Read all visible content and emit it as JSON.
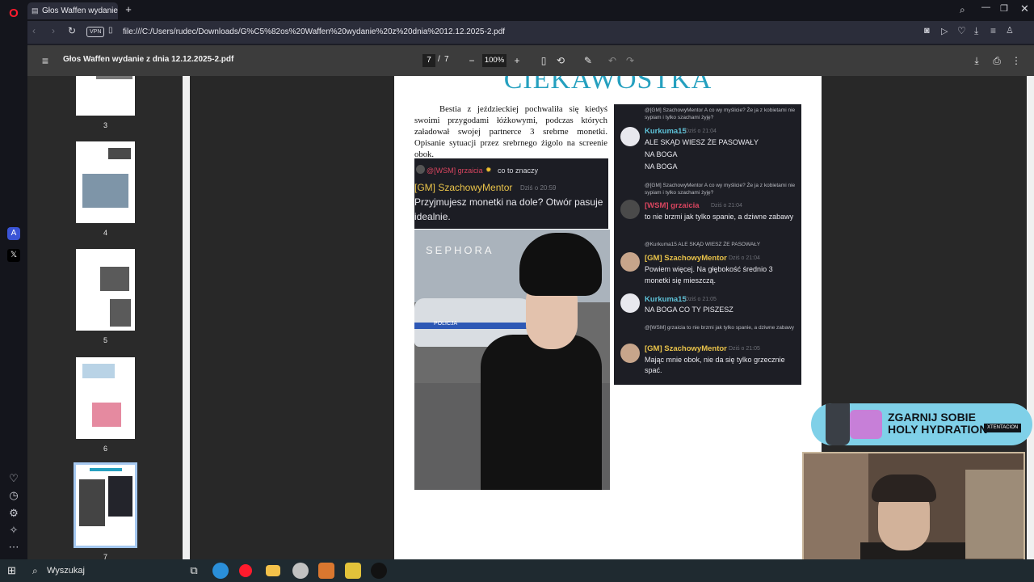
{
  "tab": {
    "title": "Głos Waffen wydanie z dn"
  },
  "address_bar": {
    "vpn_badge": "VPN",
    "url": "file:///C:/Users/rudec/Downloads/G%C5%82os%20Waffen%20wydanie%20z%20dnia%2012.12.2025-2.pdf"
  },
  "pdf_toolbar": {
    "title": "Głos Waffen wydanie z dnia 12.12.2025-2.pdf",
    "current_page": "7",
    "page_separator": "/",
    "total_pages": "7",
    "zoom": "100%"
  },
  "thumbnails": [
    {
      "label": "3"
    },
    {
      "label": "4"
    },
    {
      "label": "5"
    },
    {
      "label": "6"
    },
    {
      "label": "7"
    }
  ],
  "page": {
    "heading": "CIEKAWOSTKA",
    "article": "Bestia z jeździeckiej pochwaliła się kiedyś swoimi przygodami łóżkowymi, podczas których załadował swojej partnerce 3 srebrne monetki. Opisanie sytuacji przez srebrnego żigolo na screenie obok."
  },
  "chat_small": {
    "reply_name": "@[WSM] grzaicia",
    "reply_text": "co to znaczy",
    "author": "[GM] SzachowyMentor",
    "time": "Dziś o 20:59",
    "message": "Przyjmujesz monetki na dole? Otwór pasuje idealnie."
  },
  "photo": {
    "sign": "SEPHORA",
    "car_text": "POLICJA"
  },
  "chat_big": {
    "messages": [
      {
        "reply": "@[GM] SzachowyMentor A co wy myślicie? Że ja z kobietami nie sypiam i tylko szachami żyję?",
        "author": "Kurkuma15",
        "time": "Dziś o 21:04",
        "lines": [
          "ALE SKĄD WIESZ ŻE PASOWAŁY",
          "NA BOGA",
          "NA BOGA"
        ]
      },
      {
        "reply": "@[GM] SzachowyMentor A co wy myślicie? Że ja z kobietami nie sypiam i tylko szachami żyję?",
        "author": "[WSM] grzaicia",
        "time": "Dziś o 21:04",
        "lines": [
          "to nie brzmi jak tylko spanie, a dziwne zabawy"
        ]
      },
      {
        "reply": "@Kurkuma15 ALE SKĄD WIESZ ŻE PASOWAŁY",
        "author": "[GM] SzachowyMentor",
        "time": "Dziś o 21:04",
        "lines": [
          "Powiem więcej. Na głębokość średnio 3",
          "monetki się mieszczą."
        ]
      },
      {
        "reply": "",
        "author": "Kurkuma15",
        "time": "Dziś o 21:05",
        "lines": [
          "NA BOGA CO TY PISZESZ"
        ]
      },
      {
        "reply": "@[WSM] grzaicia to nie brzmi jak tylko spanie, a dziwne zabawy",
        "author": "[GM] SzachowyMentor",
        "time": "Dziś o 21:05",
        "lines": [
          "Mając mnie obok, nie da się tylko grzecznie",
          "spać."
        ]
      }
    ]
  },
  "promo": {
    "line1": "ZGARNIJ SOBIE",
    "line2": "HOLY HYDRATION",
    "brand": "XTENTACION"
  },
  "taskbar": {
    "search_placeholder": "Wyszukaj"
  },
  "colors": {
    "heading": "#25a0bf",
    "mentor": "#e9c34a",
    "kurkuma": "#5ec3d9",
    "grzaicia": "#d9455f",
    "chat_bg": "#1d1e25"
  }
}
